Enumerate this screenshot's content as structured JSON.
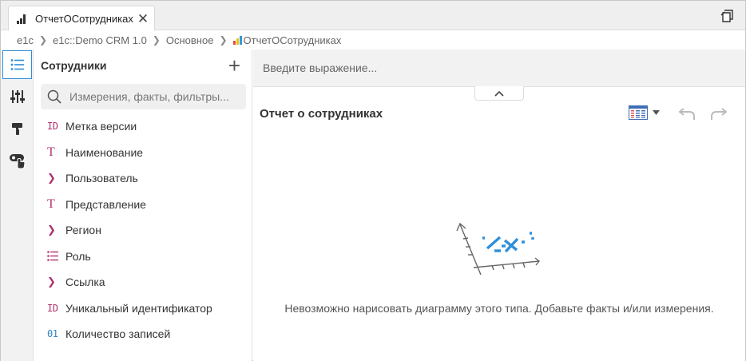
{
  "tab": {
    "title": "ОтчетОСотрудниках",
    "close": "✕"
  },
  "breadcrumb": [
    "e1c",
    "e1c::Demo CRM 1.0",
    "Основное",
    "ОтчетОСотрудниках"
  ],
  "panel": {
    "title": "Сотрудники",
    "add": "+",
    "search_placeholder": "Измерения, факты, фильтры...",
    "fields": [
      {
        "type": "ID",
        "label": "Метка версии"
      },
      {
        "type": "T",
        "label": "Наименование"
      },
      {
        "type": ">",
        "label": "Пользователь"
      },
      {
        "type": "T",
        "label": "Представление"
      },
      {
        "type": ">",
        "label": "Регион"
      },
      {
        "type": "list",
        "label": "Роль"
      },
      {
        "type": ">",
        "label": "Ссылка"
      },
      {
        "type": "ID",
        "label": "Уникальный идентификатор"
      },
      {
        "type": "01",
        "label": "Количество записей"
      }
    ]
  },
  "main": {
    "expression_placeholder": "Введите выражение...",
    "report_title": "Отчет о сотрудниках",
    "empty_message": "Невозможно нарисовать диаграмму этого типа. Добавьте факты и/или измерения."
  },
  "colors": {
    "accent": "#2d8cd9",
    "type_magenta": "#b03070",
    "type_blue": "#2e85c8"
  }
}
